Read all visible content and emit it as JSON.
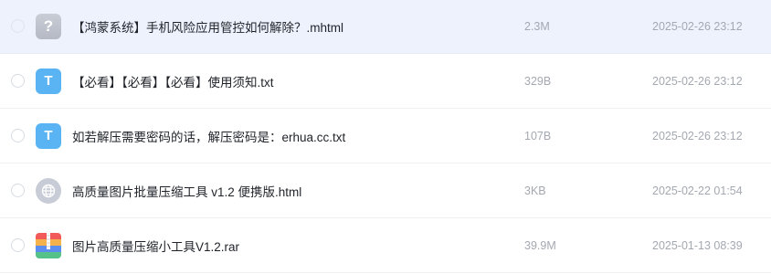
{
  "files": [
    {
      "icon": "unknown-file-icon",
      "glyph": "?",
      "name": "【鸿蒙系统】手机风险应用管控如何解除？.mhtml",
      "size": "2.3M",
      "date": "2025-02-26 23:12"
    },
    {
      "icon": "text-file-icon",
      "glyph": "T",
      "name": "【必看】【必看】【必看】使用须知.txt",
      "size": "329B",
      "date": "2025-02-26 23:12"
    },
    {
      "icon": "text-file-icon",
      "glyph": "T",
      "name": "如若解压需要密码的话，解压密码是：erhua.cc.txt",
      "size": "107B",
      "date": "2025-02-26 23:12"
    },
    {
      "icon": "html-file-icon",
      "glyph": "",
      "name": "高质量图片批量压缩工具 v1.2 便携版.html",
      "size": "3KB",
      "date": "2025-02-22 01:54"
    },
    {
      "icon": "rar-archive-icon",
      "glyph": "",
      "name": "图片高质量压缩小工具V1.2.rar",
      "size": "39.9M",
      "date": "2025-01-13 08:39"
    }
  ],
  "colors": {
    "selected_row_bg": "#eef2fd",
    "txt_icon": "#5ab4f3",
    "unknown_icon": "#c3c7d0",
    "html_icon": "#c7ccd6",
    "rar_bands": [
      "#f25a5a",
      "#f5b14b",
      "#5b8def",
      "#55c28a"
    ]
  }
}
